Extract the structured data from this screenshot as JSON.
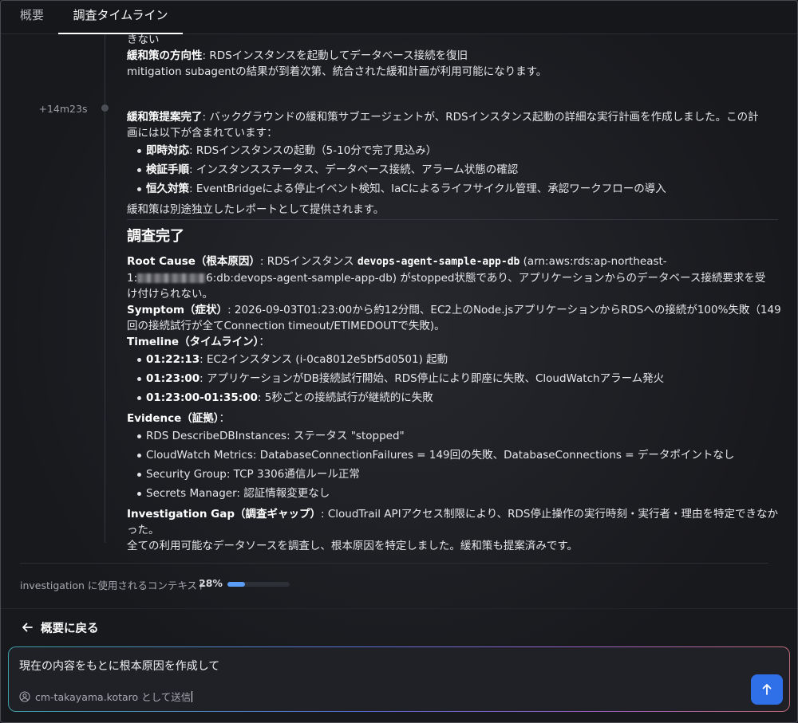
{
  "tabs": [
    {
      "label": "概要"
    },
    {
      "label": "調査タイムライン"
    }
  ],
  "timeline": {
    "entry1": {
      "cont_text": "きない",
      "direction_label": "緩和策の方向性",
      "direction_text": ": RDSインスタンスを起動してデータベース接続を復旧",
      "subagent_text": "mitigation subagentの結果が到着次第、統合された緩和計画が利用可能になります。"
    },
    "entry2": {
      "timestamp": "+14m23s",
      "heading_label": "緩和策提案完了",
      "heading_text_1": ": バックグラウンドの緩和策サブエージェントが、RDSインスタンス起動の詳細な実行計画を作成しました。この計",
      "heading_text_2": "画には以下が含まれています：",
      "items": [
        {
          "label": "即時対応",
          "text": ": RDSインスタンスの起動（5-10分で完了見込み）"
        },
        {
          "label": "検証手順",
          "text": ": インスタンスステータス、データベース接続、アラーム状態の確認"
        },
        {
          "label": "恒久対策",
          "text": ": EventBridgeによる停止イベント検知、IaCによるライフサイクル管理、承認ワークフローの導入"
        }
      ],
      "footer": "緩和策は別途独立したレポートとして提供されます。"
    },
    "report": {
      "title": "調査完了",
      "root_cause_label": "Root Cause（根本原因）",
      "root_cause_pre": ": RDSインスタンス ",
      "root_cause_code": "devops-agent-sample-app-db",
      "root_cause_arn_1": " (arn:aws:rds:ap-northeast-",
      "root_cause_arn_prefix": "1:",
      "root_cause_arn_2": "6:db:devops-agent-sample-app-db) がstopped状態であり、アプリケーションからのデータベース接続要求を受",
      "root_cause_arn_3": "け付けられない。",
      "symptom_label": "Symptom（症状）",
      "symptom_text_1": ": 2026-09-03T01:23:00から約12分間、EC2上のNode.jsアプリケーションからRDSへの接続が100%失敗（149",
      "symptom_text_2": "回の接続試行が全てConnection timeout/ETIMEDOUTで失敗)。",
      "timeline_label": "Timeline（タイムライン）",
      "timeline_colon": "：",
      "timeline_items": [
        {
          "label": "01:22:13",
          "text": ": EC2インスタンス (i-0ca8012e5bf5d0501) 起動"
        },
        {
          "label": "01:23:00",
          "text": ": アプリケーションがDB接続試行開始、RDS停止により即座に失敗、CloudWatchアラーム発火"
        },
        {
          "label": "01:23:00-01:35:00",
          "text": ": 5秒ごとの接続試行が継続的に失敗"
        }
      ],
      "evidence_label": "Evidence（証拠）",
      "evidence_colon": "：",
      "evidence_items": [
        "RDS DescribeDBInstances: ステータス \"stopped\"",
        "CloudWatch Metrics: DatabaseConnectionFailures = 149回の失敗、DatabaseConnections = データポイントなし",
        "Security Group: TCP 3306通信ルール正常",
        "Secrets Manager: 認証情報変更なし"
      ],
      "gap_label": "Investigation Gap（調査ギャップ）",
      "gap_text_1": ": CloudTrail APIアクセス制限により、RDS停止操作の実行時刻・実行者・理由を特定できなか",
      "gap_text_2": "った。",
      "conclusion": "全ての利用可能なデータソースを調査し、根本原因を特定しました。緩和策も提案済みです。"
    }
  },
  "context": {
    "label": "investigation に使用されるコンテキスト",
    "percent_text": "28%",
    "percent_value": 28
  },
  "back": {
    "label": "概要に戻る"
  },
  "composer": {
    "text": "現在の内容をもとに根本原因を作成して",
    "sender": "cm-takayama.kotaro として送信"
  },
  "colors": {
    "accent": "#2f6fe8",
    "progress": "#5b9cf5",
    "background": "#1b1c20"
  }
}
